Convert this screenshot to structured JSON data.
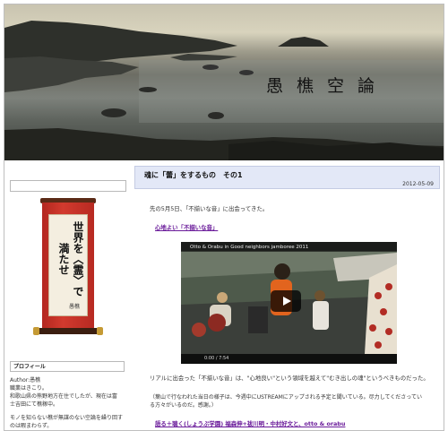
{
  "header": {
    "title": "愚樵空論"
  },
  "sidebar": {
    "scroll_text": "世界を〈霊〉で満たせ",
    "scroll_signature": "愚樵",
    "profile_heading": "プロフィール",
    "author": "Author:愚樵",
    "bio_1": "職業はきこり。",
    "bio_2": "和歌山県の熊野地方在住でしたが、現在は富",
    "bio_3": "士吉田にて樵稼中。",
    "bio_4": "モノを知らない樵が無謀のない空論を繰り回す",
    "bio_5": "のは暇まわらず。"
  },
  "post": {
    "title": "魂に「蕾」をするもの　その1",
    "date": "2012-05-09",
    "p1": "先の5月5日、「不揃いな音」に出会ってきた。",
    "link1": "心地よい「不揃いな音」",
    "video_title": "Otto & Orabu in Good neighbors jamboree 2011",
    "video_time": "0:00 / 7:54",
    "p2": "リアルに出会った「不揃いな音」は、\"心地良い\"という領域を越えて\"むき出しの魂\"というべきものだった。",
    "p3": "（葉山で行なわれた当日の様子は、今週中にUSTREAMにアップされる予定と聞いている。尽力してくださってい",
    "p3b": "る方々がいるのだ。感謝。）",
    "link2": "語る＋聴く(しょうぶ学園) 福森伸+祓川明・中村好文と、otto & orabu"
  }
}
